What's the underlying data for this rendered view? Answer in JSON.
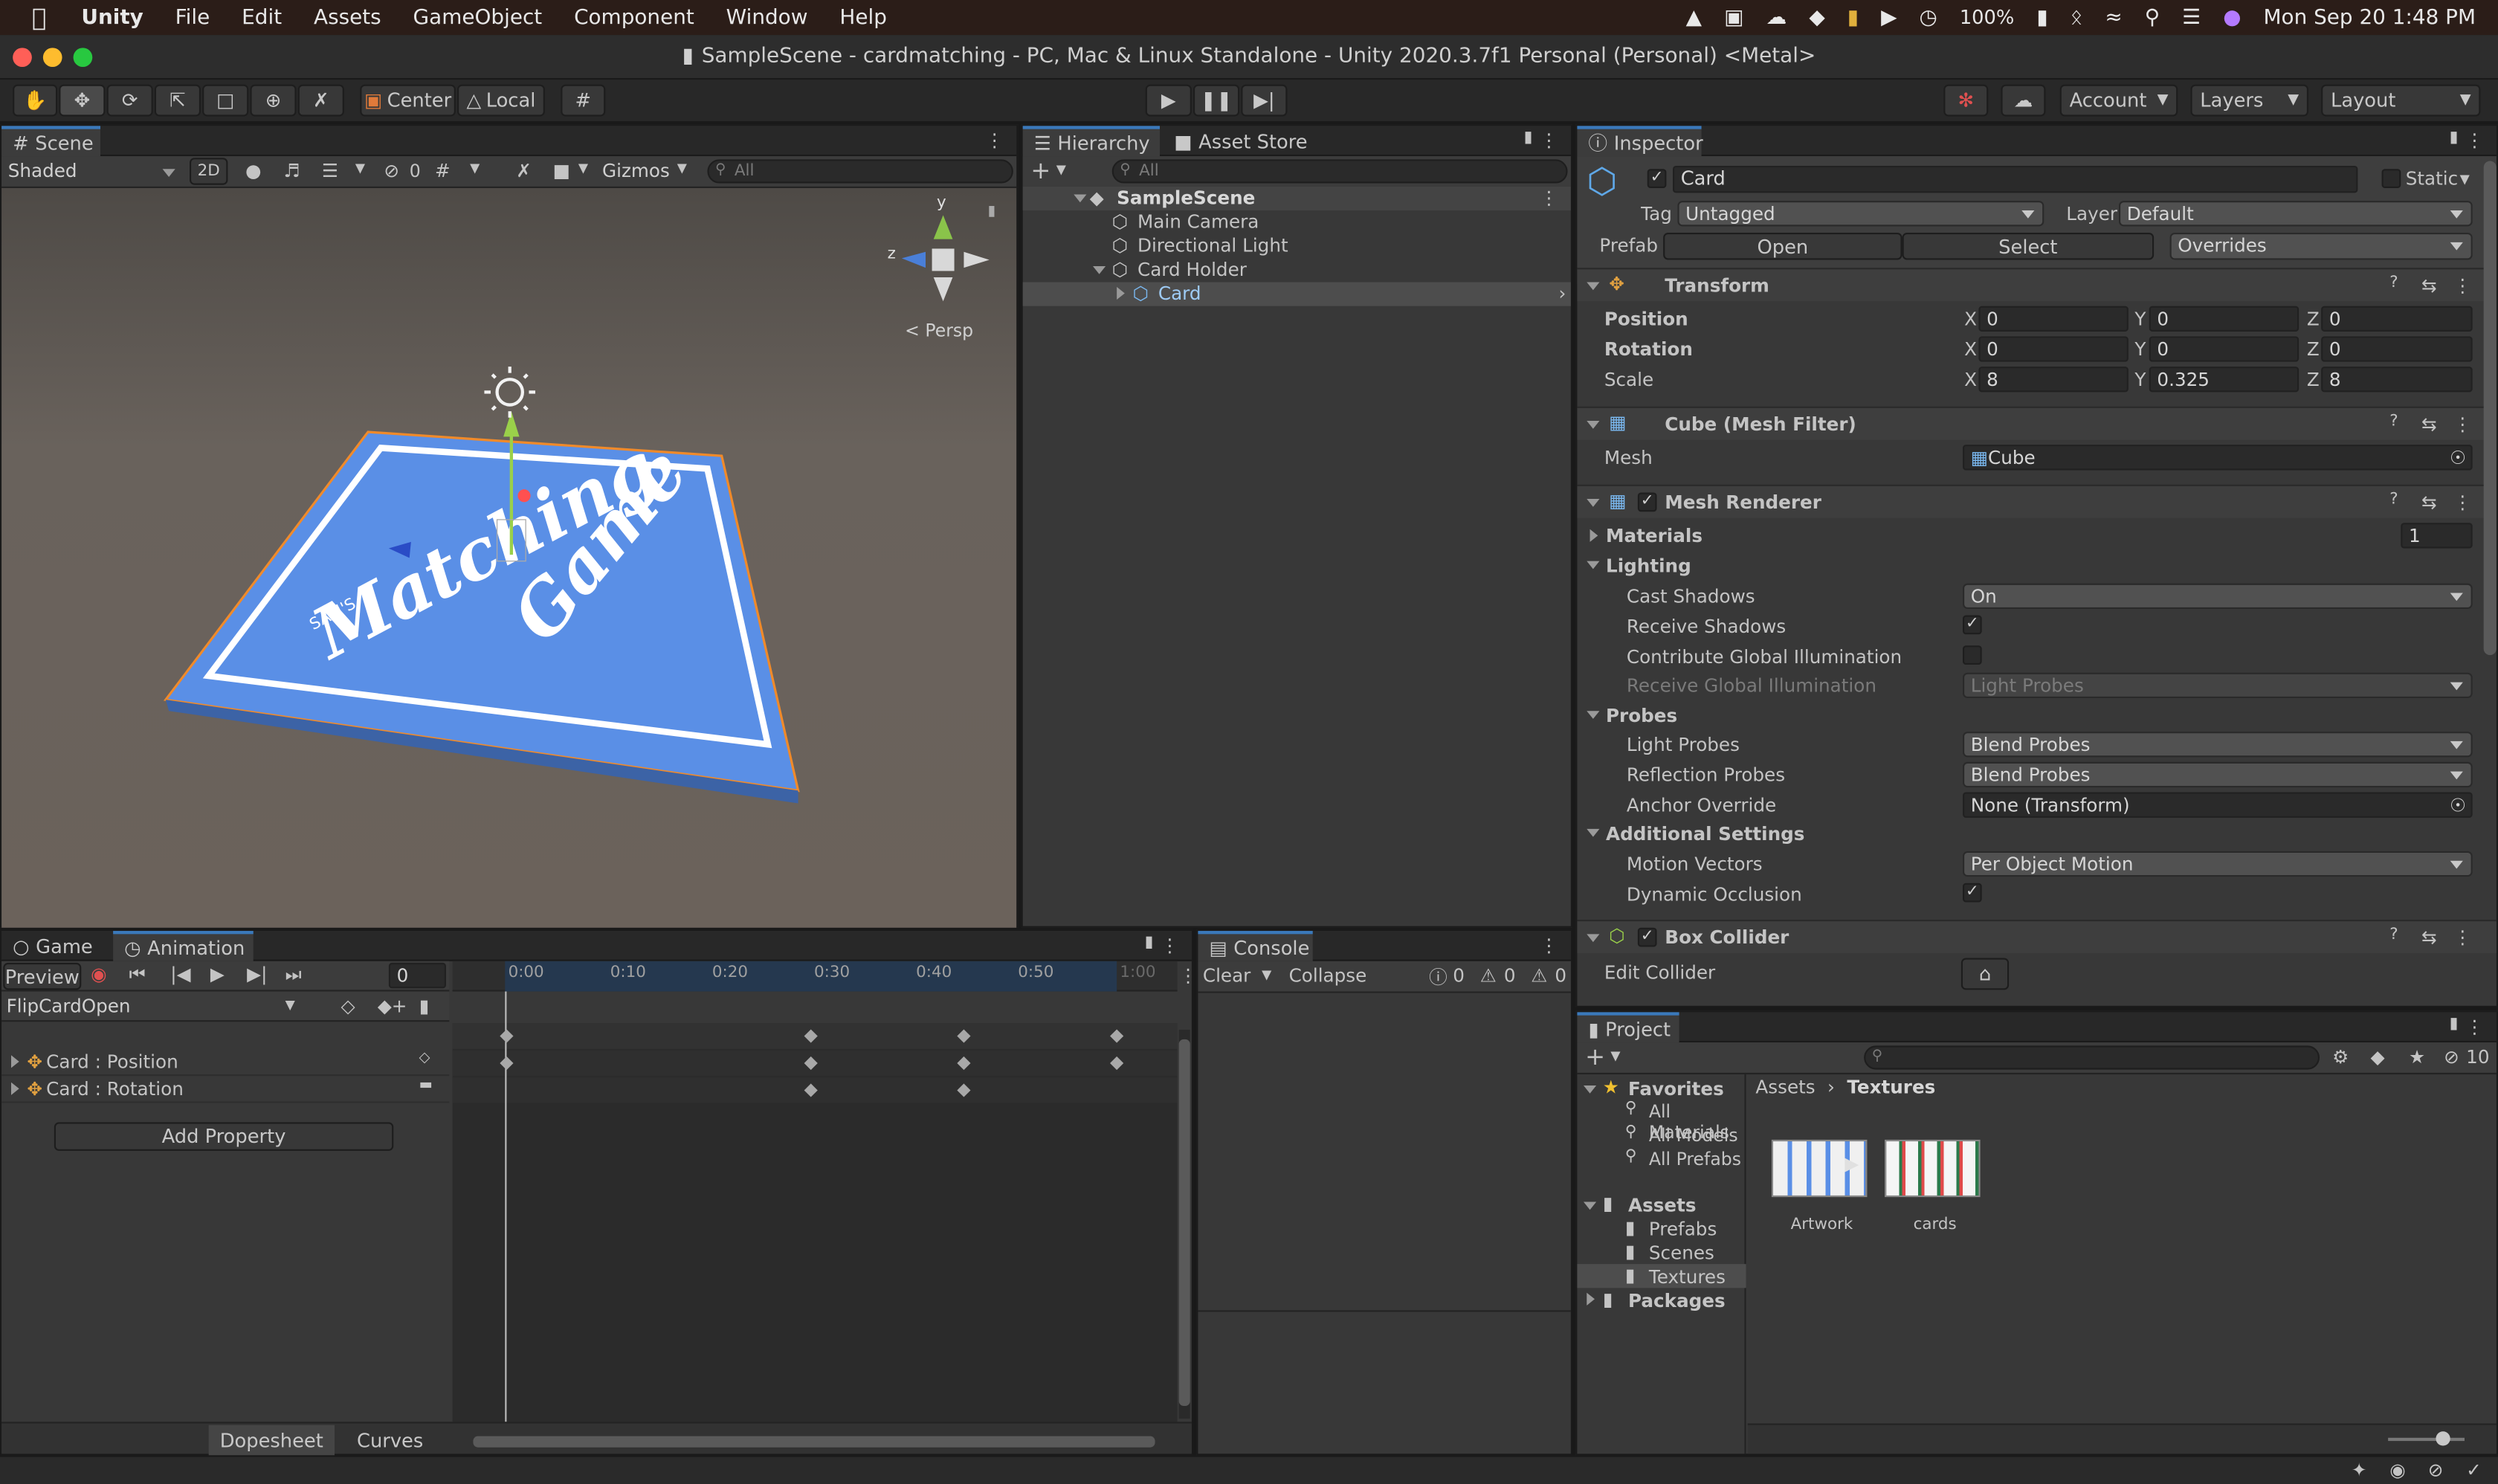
{
  "menubar": {
    "app": "Unity",
    "items": [
      "File",
      "Edit",
      "Assets",
      "GameObject",
      "Component",
      "Window",
      "Help"
    ],
    "battery": "100%",
    "datetime": "Mon Sep 20  1:48 PM"
  },
  "window": {
    "title": "SampleScene - cardmatching - PC, Mac & Linux Standalone - Unity 2020.3.7f1 Personal (Personal) <Metal>"
  },
  "toolbar": {
    "pivot": "Center",
    "space": "Local",
    "account": "Account",
    "layers": "Layers",
    "layout": "Layout"
  },
  "scene": {
    "tab": "Scene",
    "shading": "Shaded",
    "mode2d": "2D",
    "hidden_count": "0",
    "gizmos": "Gizmos",
    "search_placeholder": "All",
    "persp": "Persp",
    "axis_y": "y",
    "axis_z": "z",
    "card_brand": "SAM'S",
    "card_title_1": "Matching",
    "card_title_2": "Game"
  },
  "hierarchy": {
    "tab": "Hierarchy",
    "tab2": "Asset Store",
    "search_placeholder": "All",
    "scene": "SampleScene",
    "items": [
      "Main Camera",
      "Directional Light",
      "Card Holder",
      "Card"
    ]
  },
  "inspector": {
    "tab": "Inspector",
    "name": "Card",
    "static_label": "Static",
    "tag_label": "Tag",
    "tag": "Untagged",
    "layer_label": "Layer",
    "layer": "Default",
    "prefab_label": "Prefab",
    "open": "Open",
    "select": "Select",
    "overrides": "Overrides",
    "transform": {
      "title": "Transform",
      "rows": [
        {
          "label": "Position",
          "x": "0",
          "y": "0",
          "z": "0"
        },
        {
          "label": "Rotation",
          "x": "0",
          "y": "0",
          "z": "0"
        },
        {
          "label": "Scale",
          "x": "8",
          "y": "0.325",
          "z": "8"
        }
      ]
    },
    "mesh_filter": {
      "title": "Cube (Mesh Filter)",
      "mesh_label": "Mesh",
      "mesh": "Cube"
    },
    "mesh_renderer": {
      "title": "Mesh Renderer",
      "materials": "Materials",
      "materials_count": "1",
      "lighting": "Lighting",
      "cast_shadows_label": "Cast Shadows",
      "cast_shadows": "On",
      "receive_shadows": "Receive Shadows",
      "contrib_gi": "Contribute Global Illumination",
      "receive_gi_label": "Receive Global Illumination",
      "receive_gi": "Light Probes",
      "probes": "Probes",
      "light_probes_label": "Light Probes",
      "light_probes": "Blend Probes",
      "reflection_probes_label": "Reflection Probes",
      "reflection_probes": "Blend Probes",
      "anchor_label": "Anchor Override",
      "anchor": "None (Transform)",
      "additional": "Additional Settings",
      "motion_label": "Motion Vectors",
      "motion": "Per Object Motion",
      "dynamic_occlusion": "Dynamic Occlusion"
    },
    "box_collider": {
      "title": "Box Collider",
      "edit": "Edit Collider"
    }
  },
  "game": {
    "tab": "Game"
  },
  "animation": {
    "tab": "Animation",
    "preview": "Preview",
    "frame": "0",
    "clip": "FlipCardOpen",
    "ticks": [
      "0:00",
      "0:10",
      "0:20",
      "0:30",
      "0:40",
      "0:50",
      "1:00"
    ],
    "props": [
      "Card : Position",
      "Card : Rotation"
    ],
    "add_property": "Add Property",
    "dopesheet": "Dopesheet",
    "curves": "Curves"
  },
  "console": {
    "tab": "Console",
    "clear": "Clear",
    "collapse": "Collapse",
    "info": "0",
    "warn": "0",
    "error": "0"
  },
  "project": {
    "tab": "Project",
    "favorites": "Favorites",
    "fav_items": [
      "All Materials",
      "All Models",
      "All Prefabs"
    ],
    "assets": "Assets",
    "asset_items": [
      "Prefabs",
      "Scenes",
      "Textures"
    ],
    "packages": "Packages",
    "breadcrumb_root": "Assets",
    "breadcrumb_leaf": "Textures",
    "hidden": "10",
    "files": [
      "Artwork",
      "cards"
    ]
  },
  "colors": {
    "accent": "#3a79bb",
    "card_blue": "#5a8fe6",
    "scene_bg": "#6b625b"
  }
}
